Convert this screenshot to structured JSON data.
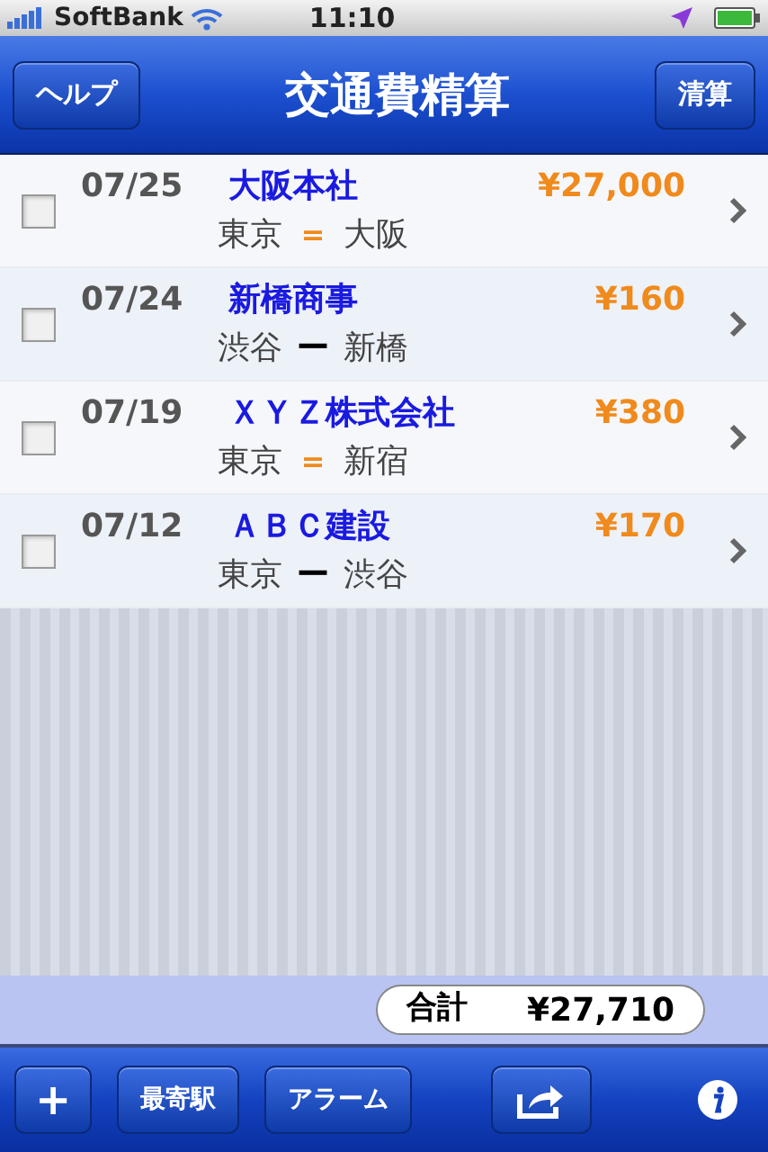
{
  "status_bar": {
    "carrier": "SoftBank",
    "time": "11:10"
  },
  "nav": {
    "title": "交通費精算",
    "left_button": "ヘルプ",
    "right_button": "清算"
  },
  "rows": [
    {
      "checked": false,
      "date": "07/25",
      "client": "大阪本社",
      "amount": "¥27,000",
      "from": "東京",
      "connector": "＝",
      "kind": "round_trip",
      "to": "大阪"
    },
    {
      "checked": false,
      "date": "07/24",
      "client": "新橋商事",
      "amount": "¥160",
      "from": "渋谷",
      "connector": "ー",
      "kind": "one_way",
      "to": "新橋"
    },
    {
      "checked": false,
      "date": "07/19",
      "client": "ＸＹＺ株式会社",
      "amount": "¥380",
      "from": "東京",
      "connector": "＝",
      "kind": "round_trip",
      "to": "新宿"
    },
    {
      "checked": false,
      "date": "07/12",
      "client": "ＡＢＣ建設",
      "amount": "¥170",
      "from": "東京",
      "connector": "ー",
      "kind": "one_way",
      "to": "渋谷"
    }
  ],
  "total": {
    "label": "合計",
    "value": "¥27,710"
  },
  "toolbar": {
    "add": "+",
    "nearest_station": "最寄駅",
    "alarm": "アラーム"
  }
}
